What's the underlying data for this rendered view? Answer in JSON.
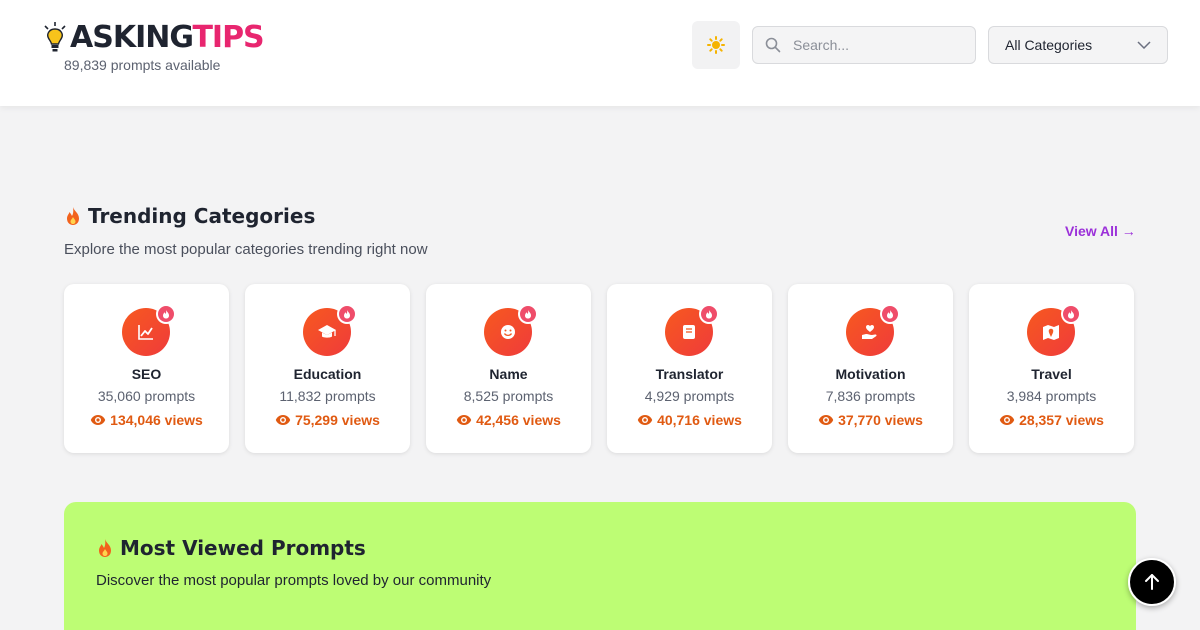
{
  "header": {
    "logo_part1": "ASKING",
    "logo_part2": "TIPS",
    "prompt_count": "89,839 prompts available",
    "search_placeholder": "Search...",
    "category_select": "All Categories"
  },
  "trending": {
    "title": "Trending Categories",
    "subtitle": "Explore the most popular categories trending right now",
    "view_all": "View All →",
    "categories": [
      {
        "name": "SEO",
        "prompts": "35,060 prompts",
        "views": "134,046 views",
        "icon": "chart-icon"
      },
      {
        "name": "Education",
        "prompts": "11,832 prompts",
        "views": "75,299 views",
        "icon": "graduation-cap-icon"
      },
      {
        "name": "Name",
        "prompts": "8,525 prompts",
        "views": "42,456 views",
        "icon": "smile-icon"
      },
      {
        "name": "Translator",
        "prompts": "4,929 prompts",
        "views": "40,716 views",
        "icon": "book-icon"
      },
      {
        "name": "Motivation",
        "prompts": "7,836 prompts",
        "views": "37,770 views",
        "icon": "hand-heart-icon"
      },
      {
        "name": "Travel",
        "prompts": "3,984 prompts",
        "views": "28,357 views",
        "icon": "map-icon"
      }
    ]
  },
  "most_viewed": {
    "title": "Most Viewed Prompts",
    "subtitle": "Discover the most popular prompts loved by our community"
  },
  "colors": {
    "accent_pink": "#e8266f",
    "accent_orange": "#e05a12",
    "accent_purple": "#9b30d9",
    "banner_green": "#bdfd74"
  }
}
